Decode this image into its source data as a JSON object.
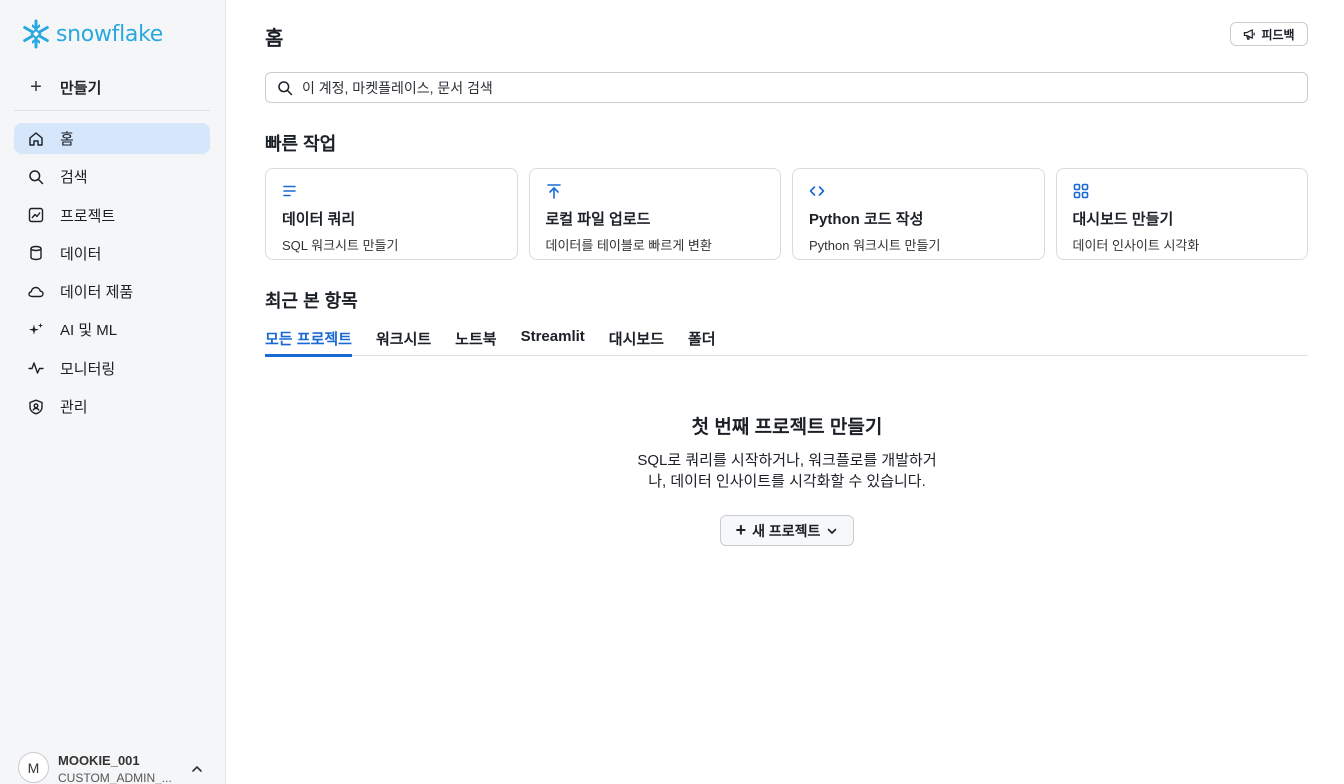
{
  "app": {
    "logo_text": "snowflake",
    "brand_color": "#29a8e0",
    "accent_color": "#1a6ad6"
  },
  "sidebar": {
    "create_label": "만들기",
    "items": [
      {
        "label": "홈",
        "icon": "home-icon",
        "active": true
      },
      {
        "label": "검색",
        "icon": "search-icon",
        "active": false
      },
      {
        "label": "프로젝트",
        "icon": "chart-box-icon",
        "active": false
      },
      {
        "label": "데이터",
        "icon": "database-icon",
        "active": false
      },
      {
        "label": "데이터 제품",
        "icon": "cloud-icon",
        "active": false
      },
      {
        "label": "AI 및 ML",
        "icon": "sparkle-icon",
        "active": false
      },
      {
        "label": "모니터링",
        "icon": "activity-icon",
        "active": false
      },
      {
        "label": "관리",
        "icon": "shield-user-icon",
        "active": false
      }
    ],
    "user": {
      "initial": "M",
      "name": "MOOKIE_001",
      "role": "CUSTOM_ADMIN_..."
    }
  },
  "header": {
    "title": "홈",
    "feedback_label": "피드백"
  },
  "search": {
    "placeholder": "이 계정, 마켓플레이스, 문서 검색"
  },
  "quick_actions": {
    "title": "빠른 작업",
    "cards": [
      {
        "title": "데이터 쿼리",
        "desc": "SQL 워크시트 만들기",
        "icon": "lines-icon"
      },
      {
        "title": "로컬 파일 업로드",
        "desc": "데이터를 테이블로 빠르게 변환",
        "icon": "upload-icon"
      },
      {
        "title": "Python 코드 작성",
        "desc": "Python 워크시트 만들기",
        "icon": "code-icon"
      },
      {
        "title": "대시보드 만들기",
        "desc": "데이터 인사이트 시각화",
        "icon": "grid-icon"
      }
    ]
  },
  "recent": {
    "title": "최근 본 항목",
    "tabs": [
      "모든 프로젝트",
      "워크시트",
      "노트북",
      "Streamlit",
      "대시보드",
      "폴더"
    ],
    "active_tab": 0
  },
  "empty_state": {
    "title": "첫 번째 프로젝트 만들기",
    "desc_line1": "SQL로 쿼리를 시작하거나, 워크플로를 개발하거",
    "desc_line2": "나, 데이터 인사이트를 시각화할 수 있습니다.",
    "button_label": "새 프로젝트"
  }
}
